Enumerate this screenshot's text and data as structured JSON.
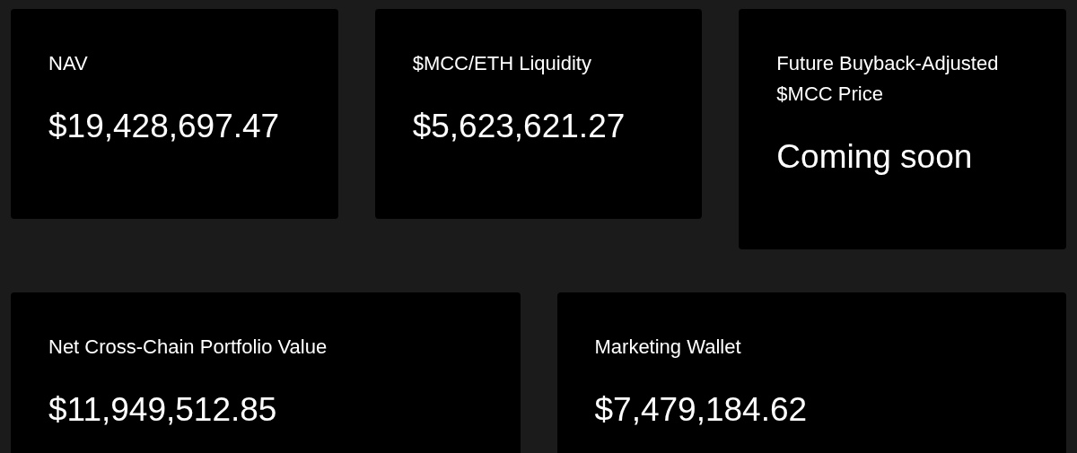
{
  "top_cards": [
    {
      "label": "NAV",
      "value": "$19,428,697.47"
    },
    {
      "label": "$MCC/ETH Liquidity",
      "value": "$5,623,621.27"
    },
    {
      "label": "Future Buyback-Adjusted $MCC Price",
      "value": "Coming soon"
    }
  ],
  "bottom_cards": [
    {
      "label": "Net Cross-Chain Portfolio Value",
      "value": "$11,949,512.85"
    },
    {
      "label": "Marketing Wallet",
      "value": "$7,479,184.62"
    }
  ]
}
